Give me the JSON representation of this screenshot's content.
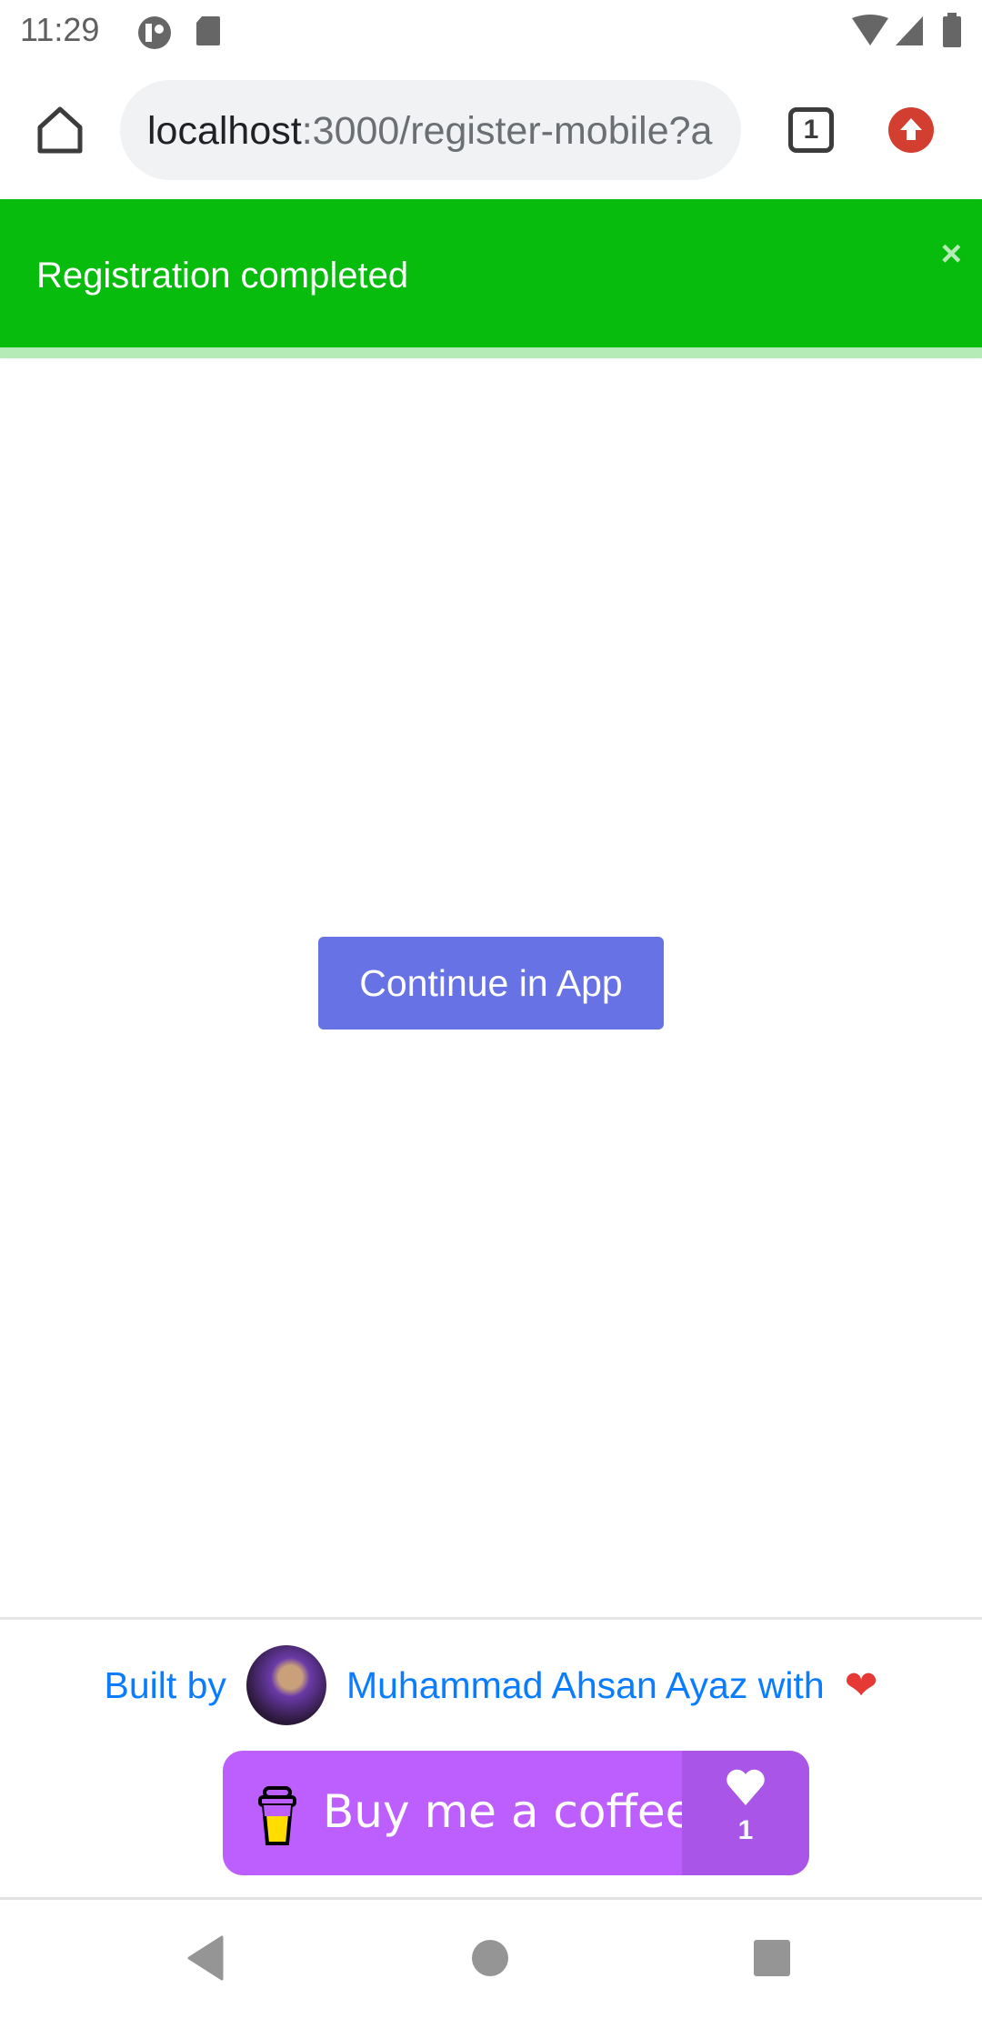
{
  "status_bar": {
    "time": "11:29"
  },
  "browser": {
    "url_host": "localhost",
    "url_rest": ":3000/register-mobile?a",
    "tab_count": "1"
  },
  "toast": {
    "message": "Registration completed",
    "close": "×",
    "progress_percent": 100
  },
  "main": {
    "continue_label": "Continue in App"
  },
  "footer": {
    "built_by": "Built by",
    "author": "Muhammad Ahsan Ayaz with",
    "heart": "❤"
  },
  "bmc": {
    "label": "Buy me a coffee",
    "count": "1"
  },
  "colors": {
    "toast": "#07bc0c",
    "button": "#6772e5",
    "bmc": "#bd5fff",
    "link": "#0a7cff"
  }
}
